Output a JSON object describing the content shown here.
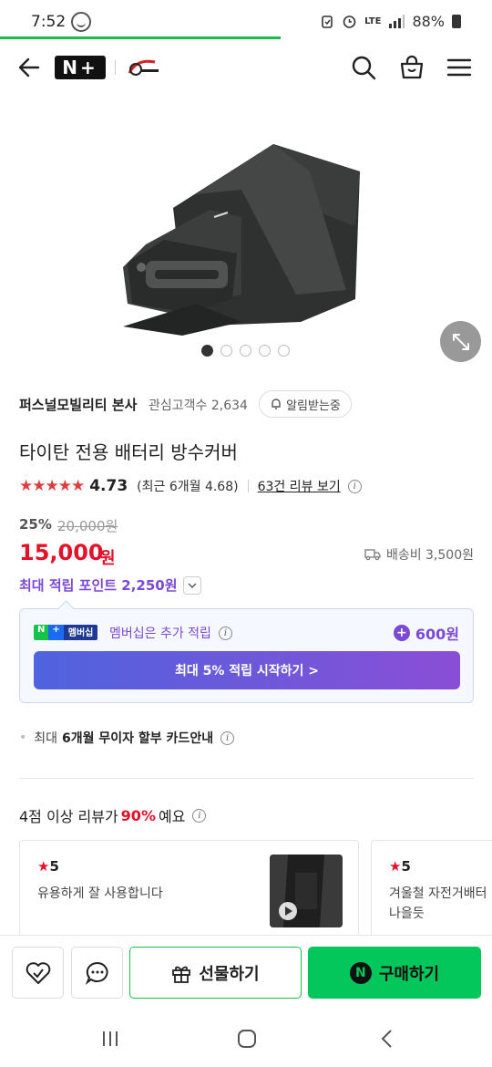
{
  "status_bar": {
    "time": "7:52",
    "lte": "LTE",
    "battery": "88%"
  },
  "nav": {
    "logo_text": "N+"
  },
  "gallery": {
    "image_count": 5,
    "active_index": 0
  },
  "store": {
    "name": "퍼스널모빌리티 본사",
    "followers_label": "관심고객수 2,634",
    "alert_label": "알림받는중"
  },
  "product": {
    "title": "타이탄 전용 배터리 방수커버",
    "stars": "★★★★★",
    "rating": "4.73",
    "recent_rating": "(최근 6개월 4.68)",
    "review_link": "63건 리뷰 보기",
    "discount": "25%",
    "original_price": "20,000원",
    "price": "15,000",
    "price_unit": "원",
    "shipping": "배송비 3,500원",
    "max_points": "최대 적립 포인트 2,250원"
  },
  "membership": {
    "badge_n": "N",
    "badge_plus": "+",
    "badge_text": "멤버십",
    "text": "멤버십은 추가 적립",
    "points": "600원",
    "cta": "최대 5% 적립 시작하기 >"
  },
  "installment": {
    "prefix": "최대",
    "text": "6개월 무이자 할부 카드안내"
  },
  "reviews": {
    "head_prefix": "4점 이상 리뷰가",
    "head_pct": "90%",
    "head_suffix": "예요",
    "cards": [
      {
        "score": "5",
        "text": "유용하게 잘 사용합니다"
      },
      {
        "score": "5",
        "text_line1": "겨울철 자전거배터",
        "text_line2": "나을듯"
      }
    ]
  },
  "bottom_bar": {
    "gift_label": "선물하기",
    "buy_label": "구매하기",
    "npay": "N"
  }
}
